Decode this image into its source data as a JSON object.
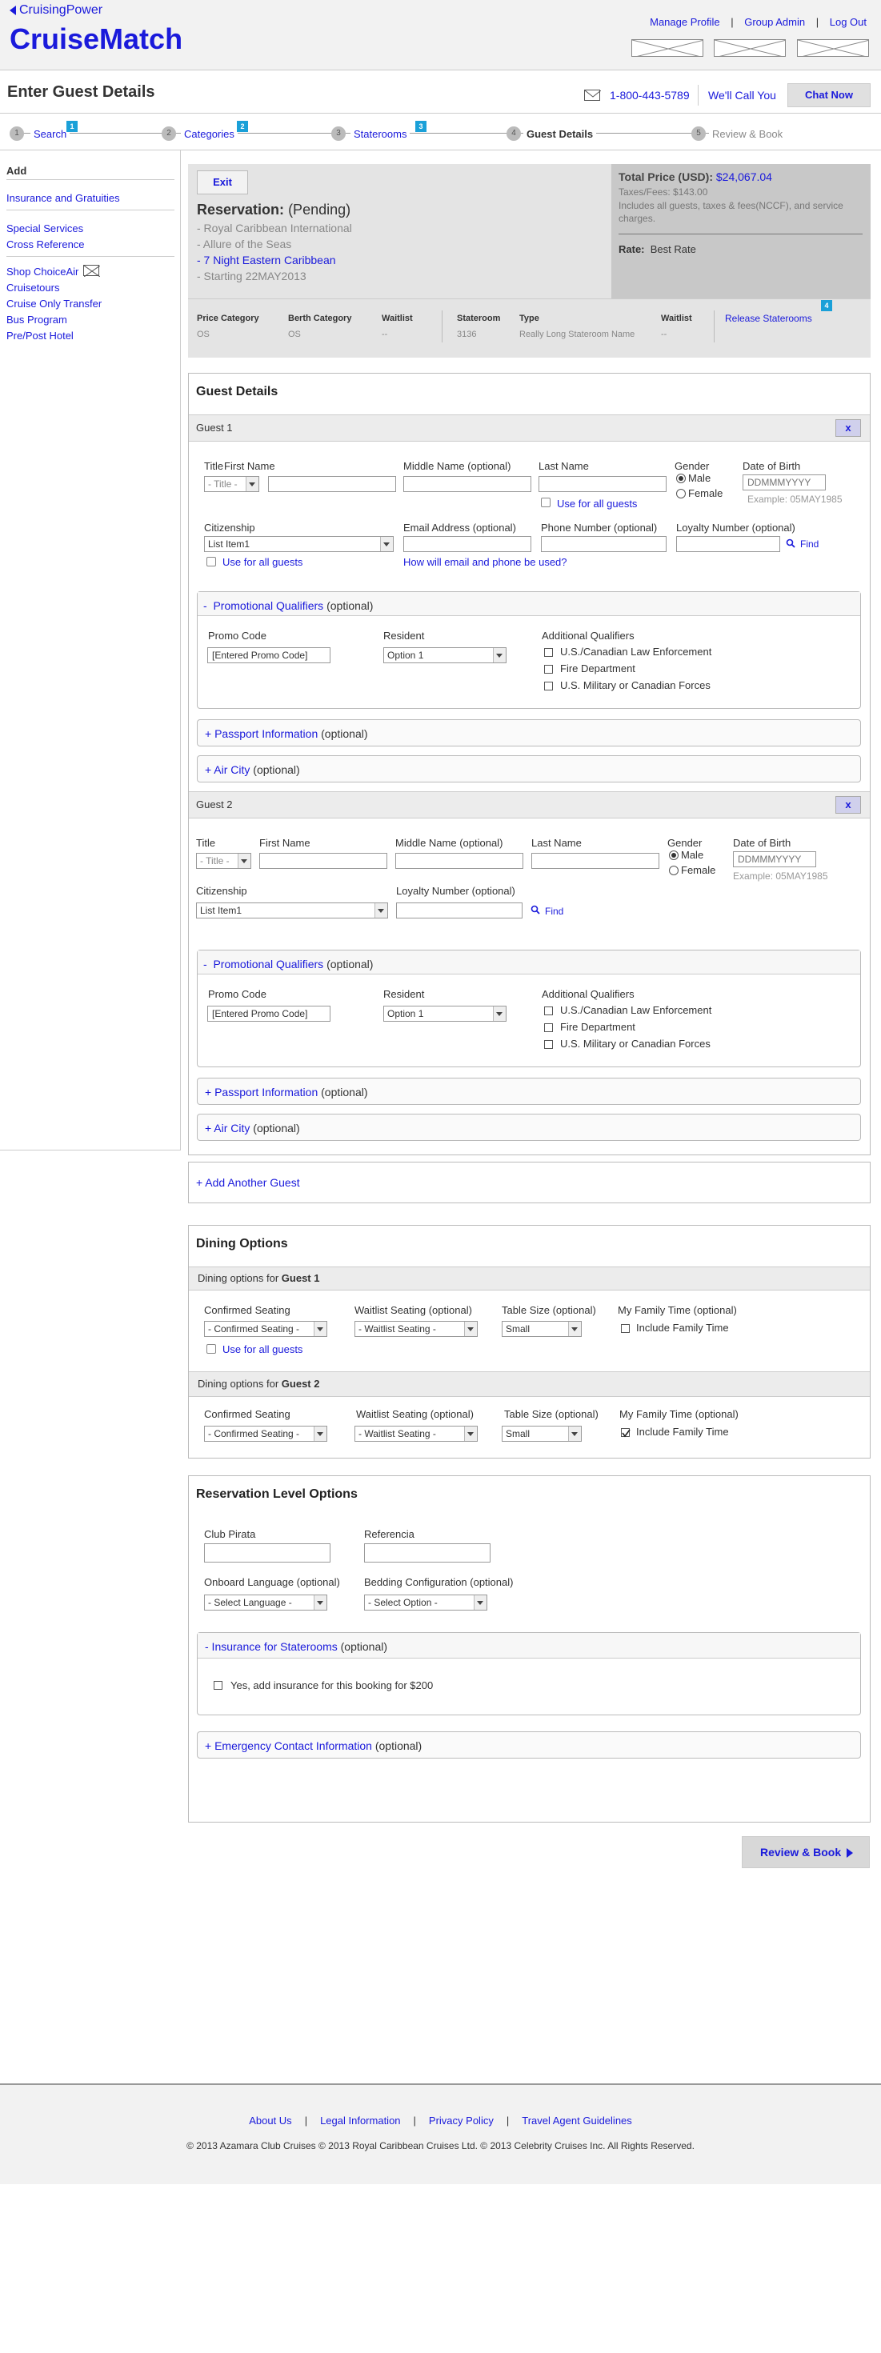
{
  "header": {
    "brand_link": "CruisingPower",
    "app_title": "CruiseMatch",
    "nav": [
      "Manage Profile",
      "Group Admin",
      "Log Out"
    ]
  },
  "subheader": {
    "title": "Enter Guest Details",
    "phone": "1-800-443-5789",
    "call_label": "We'll Call You",
    "chat_label": "Chat Now"
  },
  "steps": [
    {
      "num": "1",
      "label": "Search",
      "badge": "1"
    },
    {
      "num": "2",
      "label": "Categories",
      "badge": "2"
    },
    {
      "num": "3",
      "label": "Staterooms",
      "badge": "3"
    },
    {
      "num": "4",
      "label": "Guest Details",
      "badge": ""
    },
    {
      "num": "5",
      "label": "Review & Book",
      "badge": ""
    }
  ],
  "sidebar": {
    "title": "Add",
    "groups": [
      [
        "Insurance and Gratuities"
      ],
      [
        "Special Services",
        "Cross Reference"
      ],
      [
        "Shop ChoiceAir",
        "Cruisetours",
        "Cruise Only Transfer",
        "Bus Program",
        "Pre/Post Hotel"
      ]
    ]
  },
  "reservation": {
    "exit_label": "Exit",
    "title": "Reservation:",
    "status": "(Pending)",
    "lines": [
      "- Royal Caribbean International",
      "- Allure of the Seas",
      "- 7 Night Eastern Caribbean",
      "- Starting 22MAY2013"
    ],
    "price_label": "Total Price (USD):",
    "price": "$24,067.04",
    "taxes": "Taxes/Fees: $143.00",
    "includes": "Includes all guests, taxes & fees(NCCF), and service charges.",
    "rate_label": "Rate:",
    "rate": "Best Rate",
    "release_label": "Release Staterooms",
    "release_badge": "4",
    "cols": [
      "Price Category",
      "Berth Category",
      "Waitlist",
      "Stateroom",
      "Type",
      "Waitlist"
    ],
    "vals": [
      "OS",
      "OS",
      "--",
      "3136",
      "Really Long Stateroom Name",
      "--"
    ]
  },
  "guest_details": {
    "title": "Guest Details",
    "labels": {
      "title": "Title",
      "first": "First Name",
      "middle": "Middle Name (optional)",
      "last": "Last Name",
      "gender": "Gender",
      "male": "Male",
      "female": "Female",
      "dob": "Date of Birth",
      "dob_placeholder": "DDMMMYYYY",
      "dob_example": "Example: 05MAY1985",
      "citizenship": "Citizenship",
      "email": "Email Address (optional)",
      "phone": "Phone Number (optional)",
      "loyalty": "Loyalty Number (optional)",
      "find": "Find",
      "use_all": "Use for all guests",
      "how_used": "How will email and phone be used?",
      "title_select": "- Title -",
      "citizen_select": "List Item1"
    },
    "promo": {
      "toggle": "-",
      "title": "Promotional Qualifiers",
      "optional": "(optional)",
      "code_label": "Promo Code",
      "code_value": "[Entered Promo Code]",
      "resident_label": "Resident",
      "resident_value": "Option 1",
      "additional_label": "Additional Qualifiers",
      "qualifiers": [
        "U.S./Canadian Law Enforcement",
        "Fire Department",
        "U.S. Military or Canadian Forces"
      ]
    },
    "passport": {
      "title": "+ Passport Information",
      "optional": "(optional)"
    },
    "aircity": {
      "title": "+ Air City",
      "optional": "(optional)"
    },
    "guests": [
      {
        "name": "Guest 1",
        "close": "x"
      },
      {
        "name": "Guest 2",
        "close": "x"
      }
    ],
    "add_guest": "+ Add Another Guest"
  },
  "dining": {
    "title": "Dining Options",
    "for_label": "Dining options for",
    "guests": [
      "Guest 1",
      "Guest 2"
    ],
    "labels": [
      "Confirmed Seating",
      "Waitlist Seating (optional)",
      "Table Size (optional)",
      "My Family Time (optional)"
    ],
    "selects": [
      "- Confirmed Seating -",
      "- Waitlist Seating -",
      "Small"
    ],
    "family": "Include Family Time",
    "use_all": "Use for all guests"
  },
  "reservation_level": {
    "title": "Reservation Level Options",
    "club": "Club Pirata",
    "ref": "Referencia",
    "lang_label": "Onboard Language (optional)",
    "lang_value": "- Select Language -",
    "bed_label": "Bedding Configuration (optional)",
    "bed_value": "- Select Option -",
    "insurance_title": "- Insurance for Staterooms",
    "insurance_optional": "(optional)",
    "insurance_check": "Yes, add insurance for this booking for $200",
    "emergency_title": "+ Emergency Contact Information",
    "emergency_optional": "(optional)"
  },
  "review_button": "Review & Book",
  "footer": {
    "links": [
      "About Us",
      "Legal Information",
      "Privacy Policy",
      "Travel Agent Guidelines"
    ],
    "copyright": "© 2013 Azamara Club Cruises © 2013 Royal Caribbean Cruises Ltd. © 2013 Celebrity Cruises Inc. All Rights Reserved."
  }
}
